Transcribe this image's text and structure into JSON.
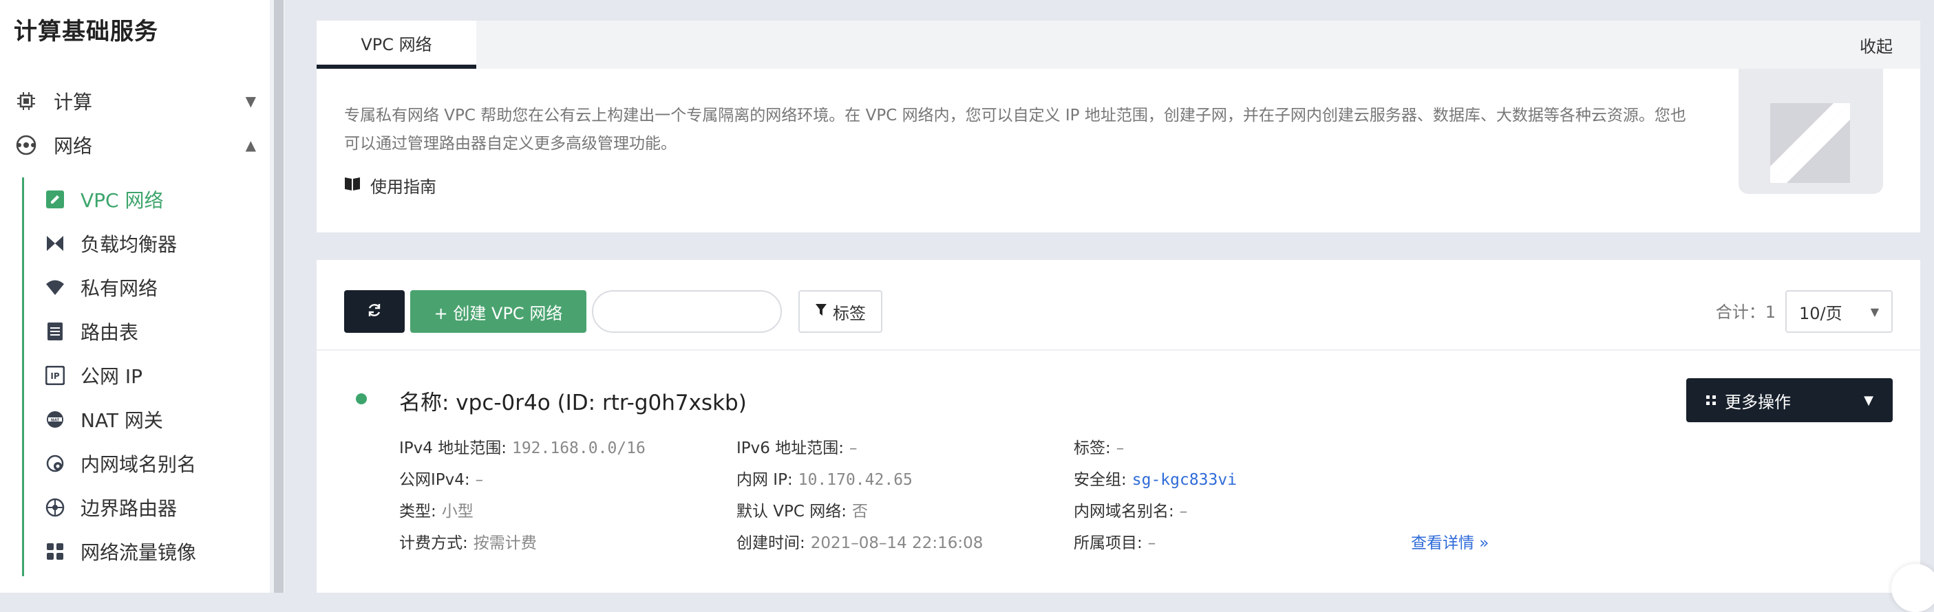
{
  "sidebar": {
    "title": "计算基础服务",
    "groups": [
      {
        "label": "计算",
        "icon": "chip-icon",
        "expanded": false
      },
      {
        "label": "网络",
        "icon": "network-icon",
        "expanded": true
      }
    ],
    "items": [
      {
        "label": "VPC 网络",
        "icon": "vpc-icon",
        "active": true
      },
      {
        "label": "负载均衡器",
        "icon": "load-balancer-icon"
      },
      {
        "label": "私有网络",
        "icon": "wifi-icon"
      },
      {
        "label": "路由表",
        "icon": "route-table-icon"
      },
      {
        "label": "公网 IP",
        "icon": "public-ip-icon"
      },
      {
        "label": "NAT 网关",
        "icon": "nat-gateway-icon"
      },
      {
        "label": "内网域名别名",
        "icon": "domain-alias-icon"
      },
      {
        "label": "边界路由器",
        "icon": "border-router-icon"
      },
      {
        "label": "网络流量镜像",
        "icon": "traffic-mirror-icon"
      }
    ]
  },
  "info": {
    "tab": "VPC 网络",
    "collapse": "收起",
    "description": "专属私有网络 VPC 帮助您在公有云上构建出一个专属隔离的网络环境。在 VPC 网络内，您可以自定义 IP 地址范围，创建子网，并在子网内创建云服务器、数据库、大数据等各种云资源。您也可以通过管理路由器自定义更多高级管理功能。",
    "guide": "使用指南"
  },
  "toolbar": {
    "create_label": "+ 创建 VPC 网络",
    "search_placeholder": "",
    "tag_label": "标签",
    "total_label": "合计：1",
    "page_size": "10/页"
  },
  "vpc": {
    "title": "名称: vpc-0r4o (ID: rtr-g0h7xskb)",
    "more_ops": "更多操作",
    "fields": [
      {
        "label": "IPv4 地址范围:",
        "value": "192.168.0.0/16"
      },
      {
        "label": "公网IPv4:",
        "value": "–"
      },
      {
        "label": "类型:",
        "value": "小型"
      },
      {
        "label": "计费方式:",
        "value": "按需计费"
      },
      {
        "label": "IPv6 地址范围:",
        "value": "–"
      },
      {
        "label": "内网 IP:",
        "value": "10.170.42.65"
      },
      {
        "label": "默认 VPC 网络:",
        "value": "否"
      },
      {
        "label": "创建时间:",
        "value": "2021–08–14 22:16:08"
      },
      {
        "label": "标签:",
        "value": "–"
      },
      {
        "label": "安全组:",
        "value": "sg-kgc833vi"
      },
      {
        "label": "内网域名别名:",
        "value": "–"
      },
      {
        "label": "所属项目:",
        "value": "–"
      }
    ],
    "detail_link": "查看详情 »"
  },
  "colors": {
    "accent_green": "#3da56c",
    "dark": "#17202b",
    "link_blue": "#2f6bd8"
  }
}
